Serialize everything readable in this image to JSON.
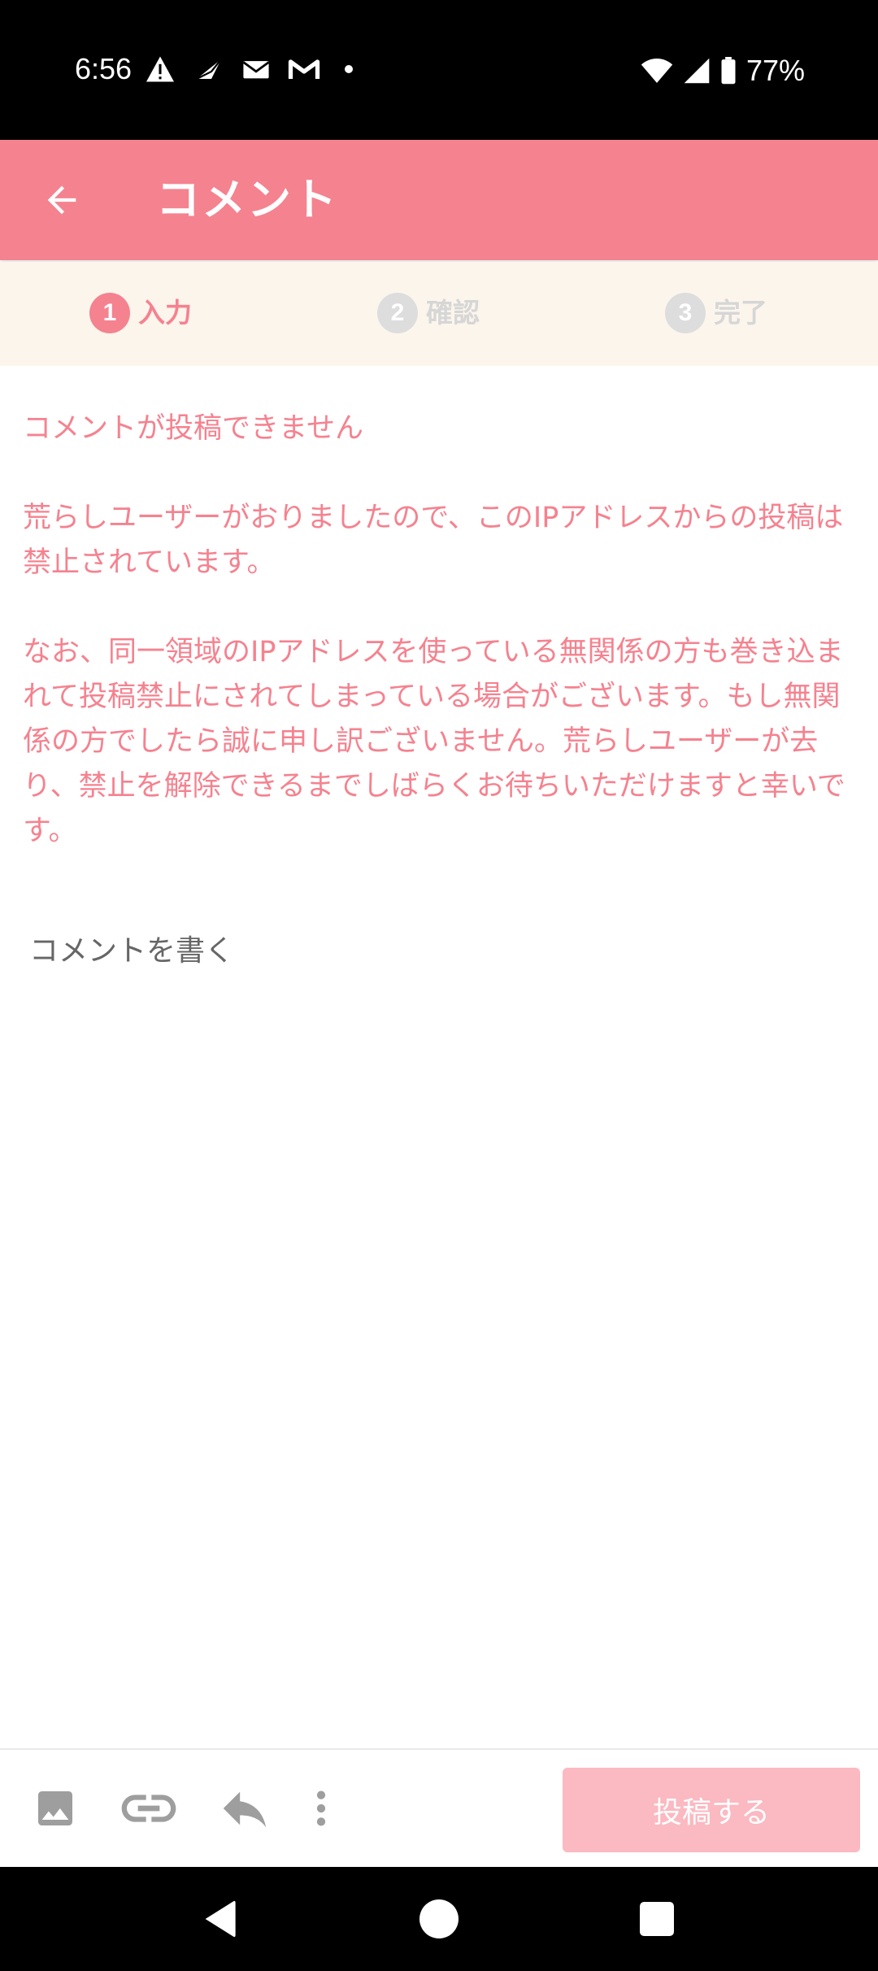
{
  "status_bar": {
    "time": "6:56",
    "battery": "77%",
    "left_icons": [
      "warning-icon",
      "send-icon",
      "mail-icon",
      "gmail-icon",
      "dot-icon"
    ],
    "right_icons": [
      "wifi-icon",
      "signal-icon",
      "battery-icon"
    ]
  },
  "app_bar": {
    "title": "コメント",
    "color": "#f5828f"
  },
  "stepper": {
    "steps": [
      {
        "number": "1",
        "label": "入力",
        "active": true
      },
      {
        "number": "2",
        "label": "確認",
        "active": false
      },
      {
        "number": "3",
        "label": "完了",
        "active": false
      }
    ]
  },
  "message": {
    "heading": "コメントが投稿できません",
    "paragraph1": "荒らしユーザーがおりましたので、このIPアドレスからの投稿は禁止されています。",
    "paragraph2": "なお、同一領域のIPアドレスを使っている無関係の方も巻き込まれて投稿禁止にされてしまっている場合がございます。もし無関係の方でしたら誠に申し訳ございません。荒らしユーザーが去り、禁止を解除できるまでしばらくお待ちいただけますと幸いです。",
    "color": "#f5828f"
  },
  "comment_input": {
    "placeholder": "コメントを書く",
    "value": ""
  },
  "toolbar": {
    "icons": [
      "image-icon",
      "link-icon",
      "reply-icon",
      "more-vert-icon"
    ],
    "post_label": "投稿する",
    "post_color": "#fbb9c1"
  },
  "nav_bar": {
    "buttons": [
      "back-triangle-icon",
      "home-circle-icon",
      "recents-square-icon"
    ]
  }
}
